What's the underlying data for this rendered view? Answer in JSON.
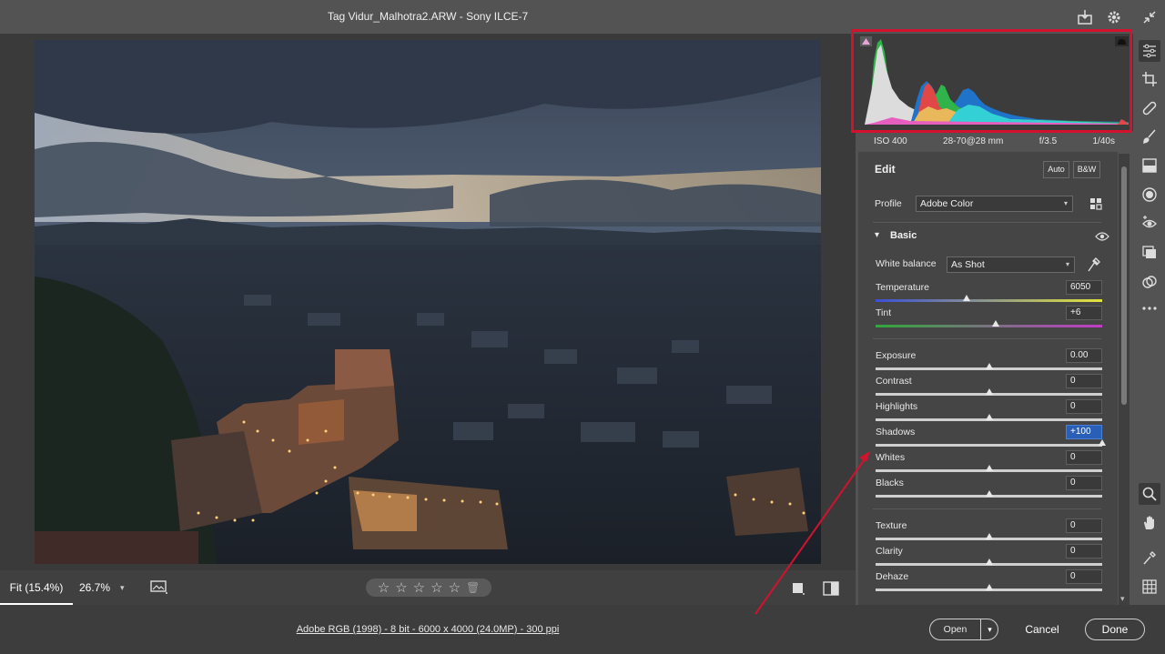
{
  "titlebar": {
    "title": "Tag Vidur_Malhotra2.ARW  -  Sony ILCE-7"
  },
  "image_toolbar": {
    "fit_label": "Fit (15.4%)",
    "zoom_label": "26.7%"
  },
  "histogram": {
    "exif": {
      "iso": "ISO 400",
      "lens": "28-70@28 mm",
      "aperture": "f/3.5",
      "shutter": "1/40s"
    }
  },
  "edit": {
    "title": "Edit",
    "auto_label": "Auto",
    "bw_label": "B&W",
    "profile_label": "Profile",
    "profile_value": "Adobe Color",
    "basic_title": "Basic",
    "white_balance_label": "White balance",
    "white_balance_value": "As Shot",
    "sliders": [
      {
        "name": "Temperature",
        "value": "6050",
        "pos": 0.4,
        "gradient": "linear-gradient(to right,#3c4fd6,#e3e33a)"
      },
      {
        "name": "Tint",
        "value": "+6",
        "pos": 0.53,
        "gradient": "linear-gradient(to right,#2faa3a,#c33ac9)"
      },
      {
        "name": "Exposure",
        "value": "0.00",
        "pos": 0.5
      },
      {
        "name": "Contrast",
        "value": "0",
        "pos": 0.5
      },
      {
        "name": "Highlights",
        "value": "0",
        "pos": 0.5
      },
      {
        "name": "Shadows",
        "value": "+100",
        "pos": 1.0,
        "active": true
      },
      {
        "name": "Whites",
        "value": "0",
        "pos": 0.5
      },
      {
        "name": "Blacks",
        "value": "0",
        "pos": 0.5
      },
      {
        "name": "Texture",
        "value": "0",
        "pos": 0.5
      },
      {
        "name": "Clarity",
        "value": "0",
        "pos": 0.5
      },
      {
        "name": "Dehaze",
        "value": "0",
        "pos": 0.5
      }
    ]
  },
  "footer": {
    "file_info": "Adobe RGB (1998) - 8 bit - 6000 x 4000 (24.0MP) - 300 ppi",
    "open_label": "Open",
    "cancel_label": "Cancel",
    "done_label": "Done"
  },
  "colors": {
    "annotation_red": "#d2122e",
    "active_field": "#2a5fb8"
  }
}
